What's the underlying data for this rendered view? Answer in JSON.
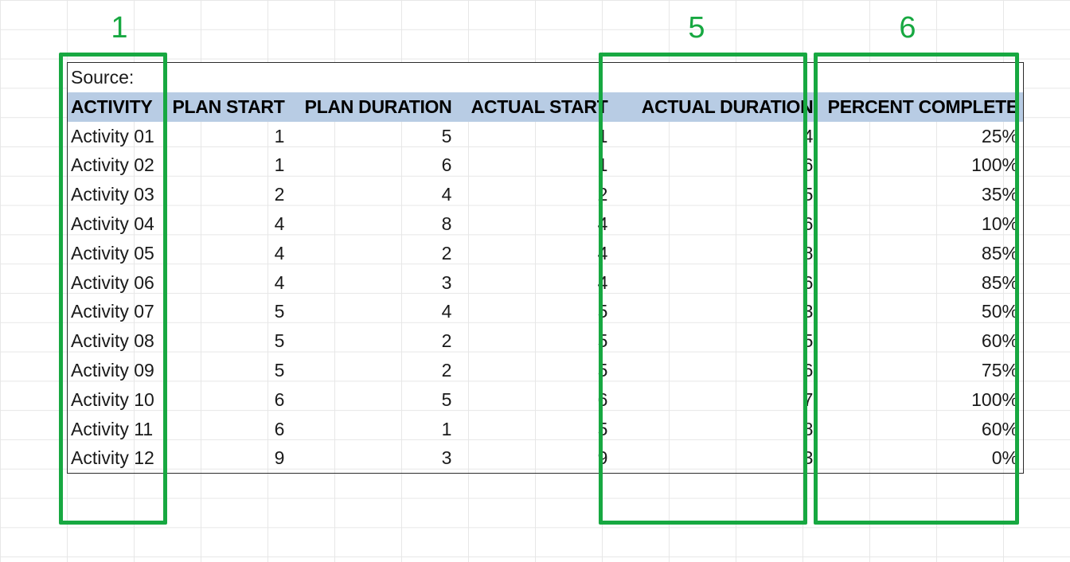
{
  "source_label": "Source:",
  "headers": {
    "activity": "ACTIVITY",
    "plan_start": "PLAN START",
    "plan_duration": "PLAN DURATION",
    "actual_start": "ACTUAL START",
    "actual_duration": "ACTUAL DURATION",
    "percent_complete": "PERCENT COMPLETE"
  },
  "rows": [
    {
      "activity": "Activity 01",
      "plan_start": "1",
      "plan_duration": "5",
      "actual_start": "1",
      "actual_duration": "4",
      "pct": "25%"
    },
    {
      "activity": "Activity 02",
      "plan_start": "1",
      "plan_duration": "6",
      "actual_start": "1",
      "actual_duration": "6",
      "pct": "100%"
    },
    {
      "activity": "Activity 03",
      "plan_start": "2",
      "plan_duration": "4",
      "actual_start": "2",
      "actual_duration": "5",
      "pct": "35%"
    },
    {
      "activity": "Activity 04",
      "plan_start": "4",
      "plan_duration": "8",
      "actual_start": "4",
      "actual_duration": "6",
      "pct": "10%"
    },
    {
      "activity": "Activity 05",
      "plan_start": "4",
      "plan_duration": "2",
      "actual_start": "4",
      "actual_duration": "8",
      "pct": "85%"
    },
    {
      "activity": "Activity 06",
      "plan_start": "4",
      "plan_duration": "3",
      "actual_start": "4",
      "actual_duration": "6",
      "pct": "85%"
    },
    {
      "activity": "Activity 07",
      "plan_start": "5",
      "plan_duration": "4",
      "actual_start": "5",
      "actual_duration": "3",
      "pct": "50%"
    },
    {
      "activity": "Activity 08",
      "plan_start": "5",
      "plan_duration": "2",
      "actual_start": "5",
      "actual_duration": "5",
      "pct": "60%"
    },
    {
      "activity": "Activity 09",
      "plan_start": "5",
      "plan_duration": "2",
      "actual_start": "5",
      "actual_duration": "6",
      "pct": "75%"
    },
    {
      "activity": "Activity 10",
      "plan_start": "6",
      "plan_duration": "5",
      "actual_start": "6",
      "actual_duration": "7",
      "pct": "100%"
    },
    {
      "activity": "Activity 11",
      "plan_start": "6",
      "plan_duration": "1",
      "actual_start": "5",
      "actual_duration": "8",
      "pct": "60%"
    },
    {
      "activity": "Activity 12",
      "plan_start": "9",
      "plan_duration": "3",
      "actual_start": "9",
      "actual_duration": "3",
      "pct": "0%"
    }
  ],
  "annotations": {
    "col1_label": "1",
    "col5_label": "5",
    "col6_label": "6"
  },
  "colors": {
    "highlight_green": "#17a841",
    "header_fill": "#b8cce4"
  }
}
